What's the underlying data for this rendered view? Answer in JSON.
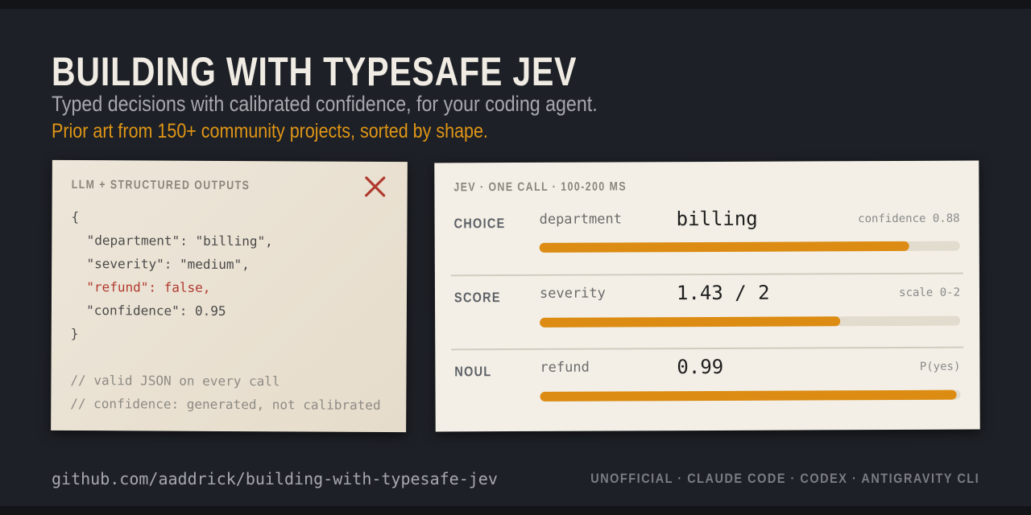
{
  "header": {
    "title": "BUILDING WITH TYPESAFE JEV",
    "subtitle": "Typed decisions with calibrated confidence, for your coding agent.",
    "tagline": "Prior art from 150+ community projects, sorted by shape."
  },
  "left_card": {
    "label": "LLM + STRUCTURED OUTPUTS",
    "close_icon": "close-icon",
    "code_lines": {
      "open": "{",
      "department": "  \"department\": \"billing\",",
      "severity": "  \"severity\": \"medium\",",
      "refund": "  \"refund\": false,",
      "confidence": "  \"confidence\": 0.95",
      "close": "}"
    },
    "comments": {
      "c1": "// valid JSON on every call",
      "c2": "// confidence: generated, not calibrated"
    }
  },
  "right_card": {
    "label": "JEV · ONE CALL · 100-200 MS",
    "rows": [
      {
        "kind": "CHOICE",
        "field": "department",
        "value": "billing",
        "meta": "confidence 0.88",
        "fill": 0.88
      },
      {
        "kind": "SCORE",
        "field": "severity",
        "value": "1.43 / 2",
        "meta": "scale 0-2",
        "fill": 0.715
      },
      {
        "kind": "NOUL",
        "field": "refund",
        "value": "0.99",
        "meta": "P(yes)",
        "fill": 0.99
      }
    ]
  },
  "footer": {
    "url": "github.com/aaddrick/building-with-typesafe-jev",
    "tags": "UNOFFICIAL · CLAUDE CODE · CODEX · ANTIGRAVITY CLI"
  },
  "colors": {
    "background": "#1d2026",
    "accent": "#dc8c12",
    "error": "#b03a2e"
  }
}
